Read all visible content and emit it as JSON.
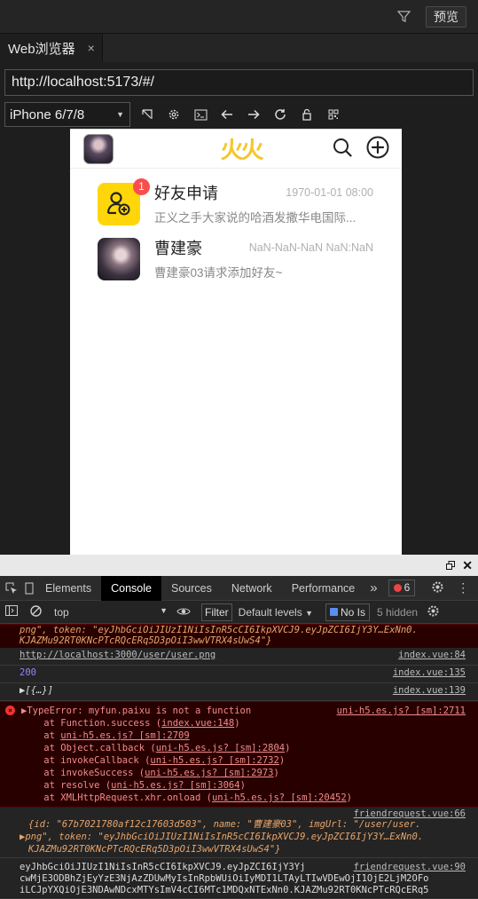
{
  "topbar": {
    "preview_label": "预览"
  },
  "tab": {
    "title": "Web浏览器",
    "close": "×"
  },
  "url": {
    "value": "http://localhost:5173/#/"
  },
  "device": {
    "selected": "iPhone 6/7/8"
  },
  "app": {
    "logo": "火火",
    "chats": [
      {
        "name": "好友申请",
        "time": "1970-01-01 08:00",
        "message": "正义之手大家说的哈酒发撒华电国际...",
        "badge": "1"
      },
      {
        "name": "曹建豪",
        "time": "NaN-NaN-NaN NaN:NaN",
        "message": "曹建豪03请求添加好友~"
      }
    ]
  },
  "devtools": {
    "tabs": [
      "Elements",
      "Console",
      "Sources",
      "Network",
      "Performance"
    ],
    "active_tab": "Console",
    "more": "»",
    "error_count": "6",
    "context": "top",
    "filter_label": "Filter",
    "levels_label": "Default levels",
    "issues_label": "No Is",
    "hidden_label": "5 hidden",
    "lines": {
      "l0": "png\", token: \"eyJhbGciOiJIUzI1NiIsInR5cCI6IkpXVCJ9.eyJpZCI6IjY3Y…ExNn0.",
      "l0b": "KJAZMu92RT0KNcPTcRQcERq5D3pOiI3wwVTRX4sUwS4\"}",
      "l1": "http://localhost:3000/user/user.png",
      "l1src": "index.vue:84",
      "l2": "200",
      "l2src": "index.vue:135",
      "l3": "▶[{…}]",
      "l3src": "index.vue:139",
      "e0": "▶TypeError: myfun.paixu is not a function",
      "e0src": "uni-h5.es.js? [sm]:2711",
      "e1a": "    at Function.success (",
      "e1b": "index.vue:148",
      "e1c": ")",
      "e2a": "    at ",
      "e2b": "uni-h5.es.js? [sm]:2709",
      "e3a": "    at Object.callback (",
      "e3b": "uni-h5.es.js? [sm]:2804",
      "e3c": ")",
      "e4a": "    at invokeCallback (",
      "e4b": "uni-h5.es.js? [sm]:2732",
      "e4c": ")",
      "e5a": "    at invokeSuccess (",
      "e5b": "uni-h5.es.js? [sm]:2973",
      "e5c": ")",
      "e6a": "    at resolve (",
      "e6b": "uni-h5.es.js? [sm]:3064",
      "e6c": ")",
      "e7a": "    at XMLHttpRequest.xhr.onload (",
      "e7b": "uni-h5.es.js? [sm]:20452",
      "e7c": ")",
      "f0src": "friendrequest.vue:66",
      "f1": "{id: \"67b7021780af12c17603d503\", name: \"曹建豪03\", imgUrl: \"/user/user.",
      "f2": "▶png\", token: \"eyJhbGciOiJIUzI1NiIsInR5cCI6IkpXVCJ9.eyJpZCI6IjY3Y…ExNn0.",
      "f3": "KJAZMu92RT0KNcPTcRQcERq5D3pOiI3wwVTRX4sUwS4\"}",
      "g0": "eyJhbGciOiJIUzI1NiIsInR5cCI6IkpXVCJ9.eyJpZCI6IjY3Yj",
      "g0src": "friendrequest.vue:90",
      "g1": "cwMjE3ODBhZjEyYzE3NjAzZDUwMyIsInRpbWUiOiIyMDI1LTAyLTIwVDEwOjI1OjE2LjM2OFo",
      "g2": "iLCJpYXQiOjE3NDAwNDcxMTYsImV4cCI6MTc1MDQxNTExNn0.KJAZMu92RT0KNcPTcRQcERq5"
    }
  }
}
